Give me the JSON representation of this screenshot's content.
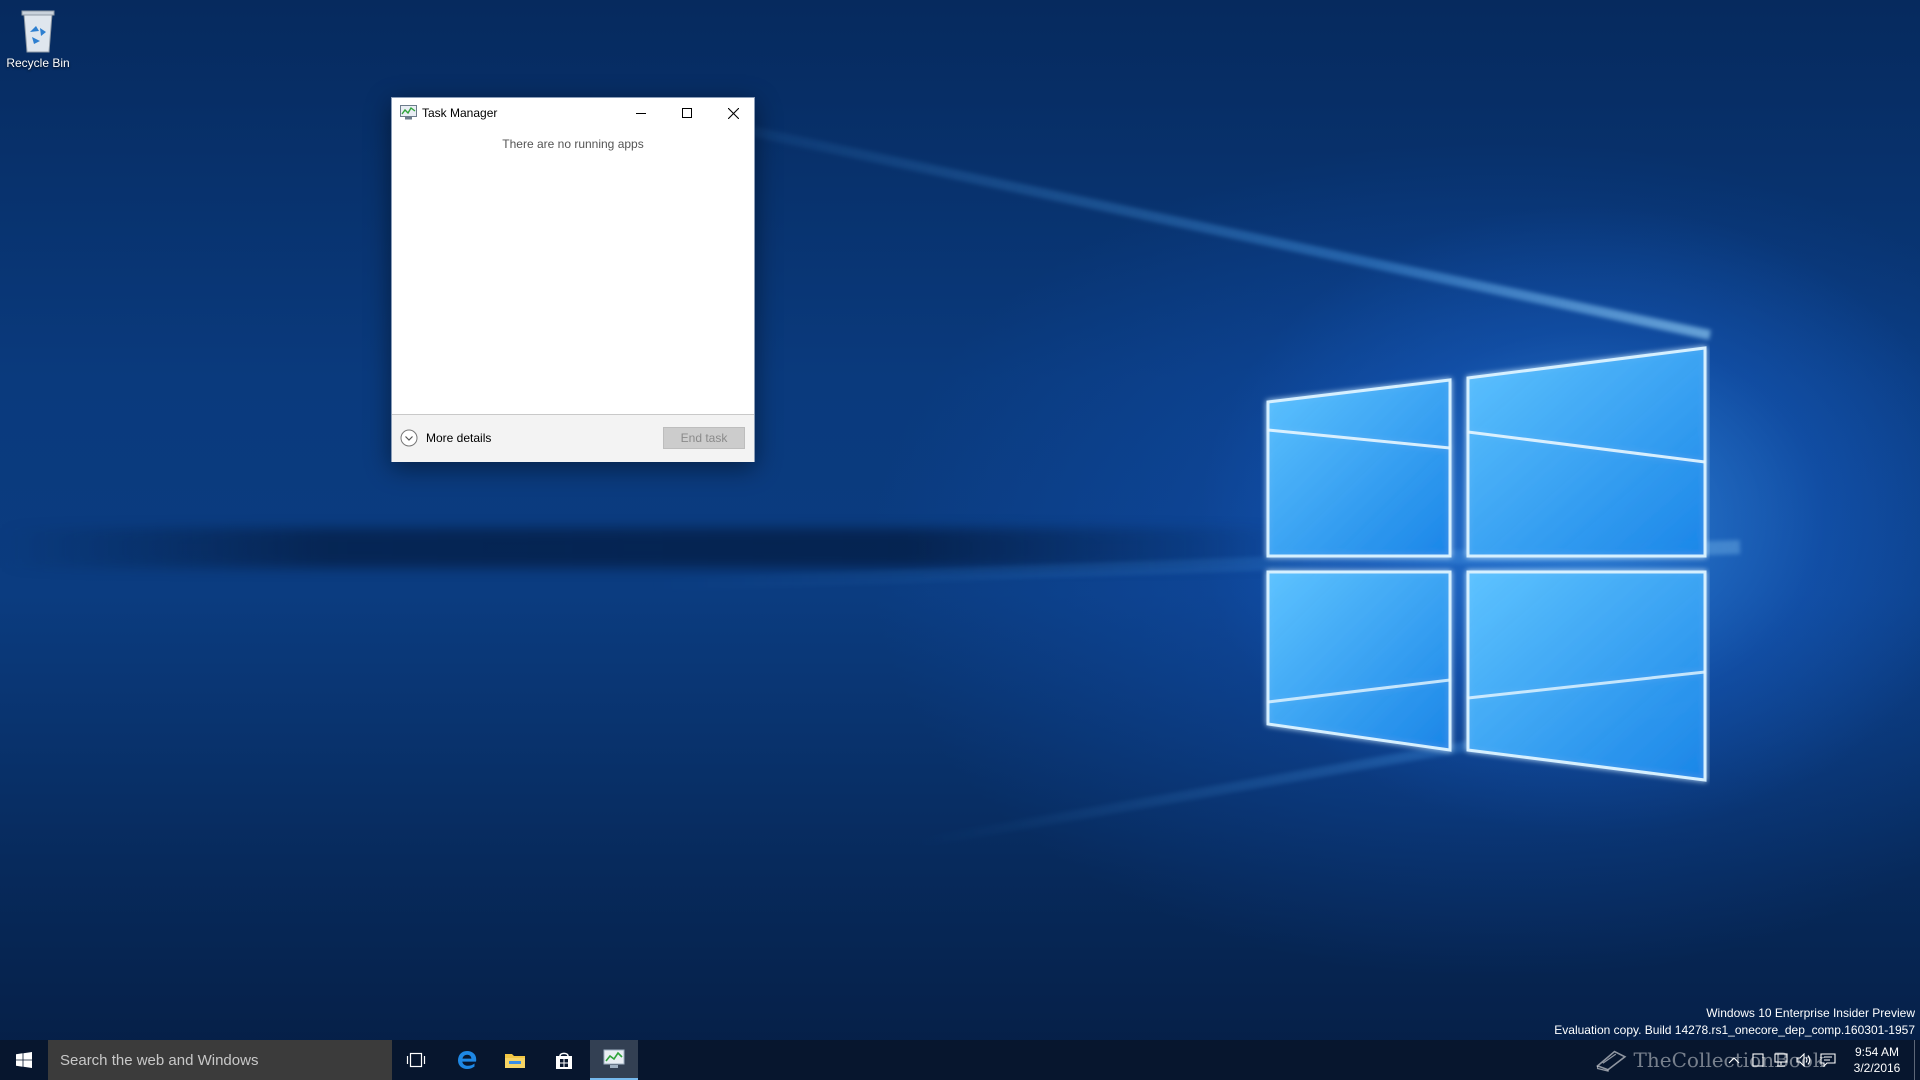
{
  "desktop": {
    "icons": [
      {
        "label": "Recycle Bin",
        "icon": "recycle-bin-icon"
      }
    ]
  },
  "task_manager": {
    "title": "Task Manager",
    "empty_message": "There are no running apps",
    "more_details_label": "More details",
    "end_task_label": "End task",
    "controls": [
      "minimize-icon",
      "maximize-icon",
      "close-icon"
    ]
  },
  "watermark": {
    "line1": "Windows 10 Enterprise Insider Preview",
    "line2": "Evaluation copy. Build 14278.rs1_onecore_dep_comp.160301-1957"
  },
  "taskbar": {
    "search_placeholder": "Search the web and Windows",
    "pinned": [
      "task-view-icon",
      "edge-icon",
      "file-explorer-icon",
      "store-icon",
      "task-manager-icon"
    ],
    "active_app": "task-manager-icon",
    "tray_overlay_text": "TheCollectionBook",
    "clock": {
      "time": "9:54 AM",
      "date": "3/2/2016"
    }
  },
  "colors": {
    "taskbar_bg": "#08162d",
    "search_bg": "#3b3b3b",
    "accent": "#76b9ed",
    "button_disabled_bg": "#cccccc"
  }
}
